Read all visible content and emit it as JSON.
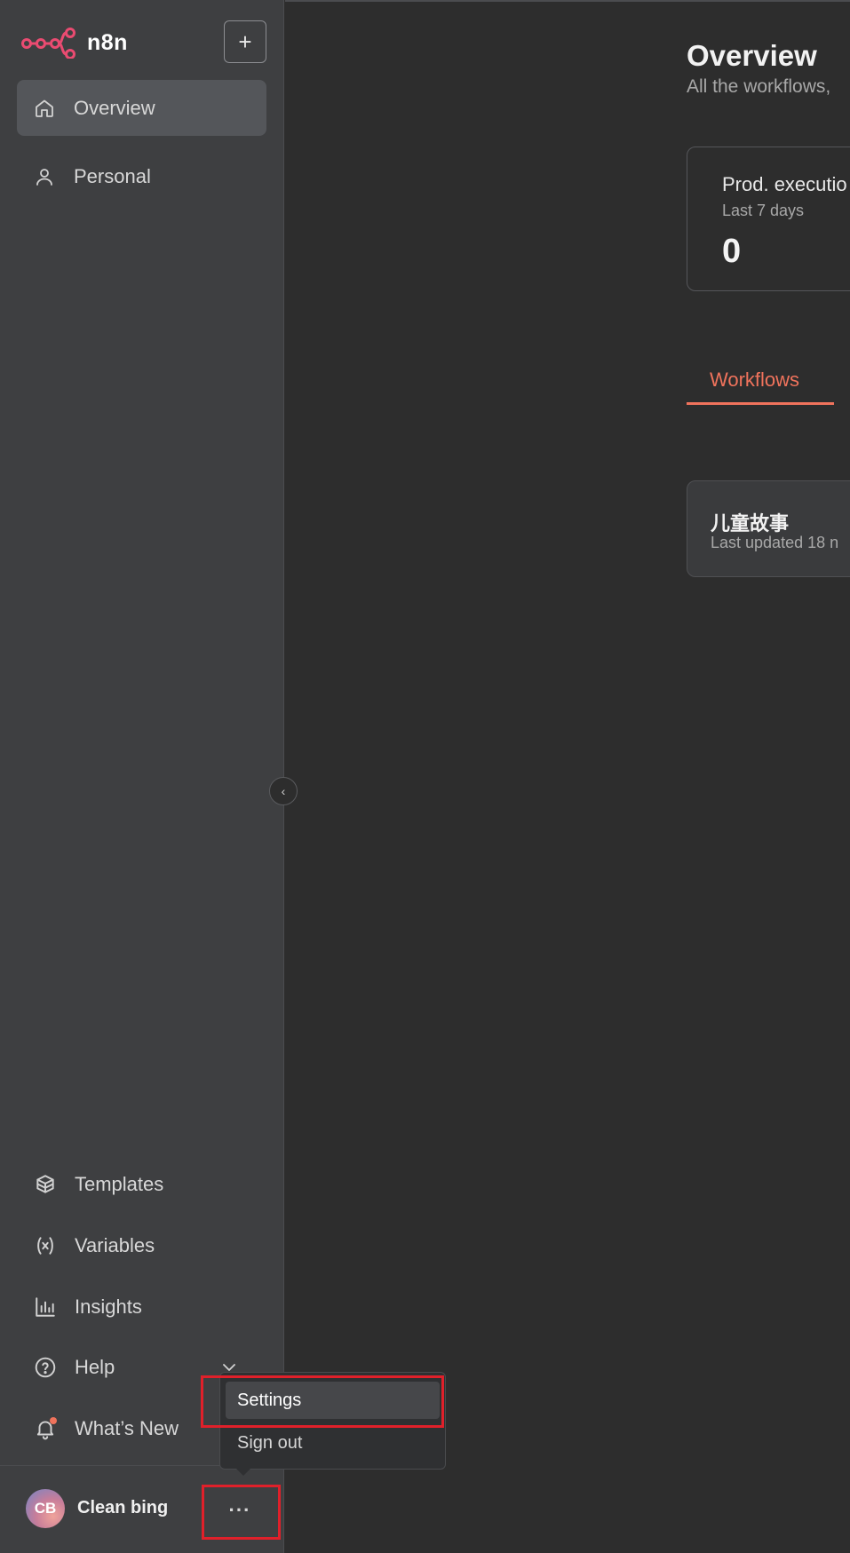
{
  "app": {
    "name": "n8n"
  },
  "colors": {
    "brand": "#ea4b71",
    "accent": "#f0735c",
    "highlight": "#e0202a"
  },
  "sidebar": {
    "new_button": {
      "icon": "plus-icon",
      "label": "+"
    },
    "collapse_icon": "chevron-left-icon",
    "collapse_glyph": "‹",
    "nav": [
      {
        "label": "Overview",
        "icon": "home-icon",
        "active": true
      },
      {
        "label": "Personal",
        "icon": "user-icon",
        "active": false
      }
    ],
    "bottom": [
      {
        "label": "Templates",
        "icon": "box-icon"
      },
      {
        "label": "Variables",
        "icon": "variable-icon"
      },
      {
        "label": "Insights",
        "icon": "bar-chart-icon"
      },
      {
        "label": "Help",
        "icon": "help-circle-icon"
      },
      {
        "label": "What’s New",
        "icon": "bell-icon"
      }
    ],
    "user": {
      "initials": "CB",
      "name": "Clean bing",
      "more": "···"
    }
  },
  "user_menu": {
    "items": [
      {
        "label": "Settings",
        "hovered": true
      },
      {
        "label": "Sign out",
        "hovered": false
      }
    ]
  },
  "main": {
    "title": "Overview",
    "subtitle": "All the workflows,",
    "stat_card": {
      "title": "Prod. executio",
      "period": "Last 7 days",
      "value": "0"
    },
    "tabs": [
      {
        "label": "Workflows",
        "active": true
      }
    ],
    "workflows": [
      {
        "name": "儿童故事",
        "updated": "Last updated 18 n"
      }
    ]
  }
}
